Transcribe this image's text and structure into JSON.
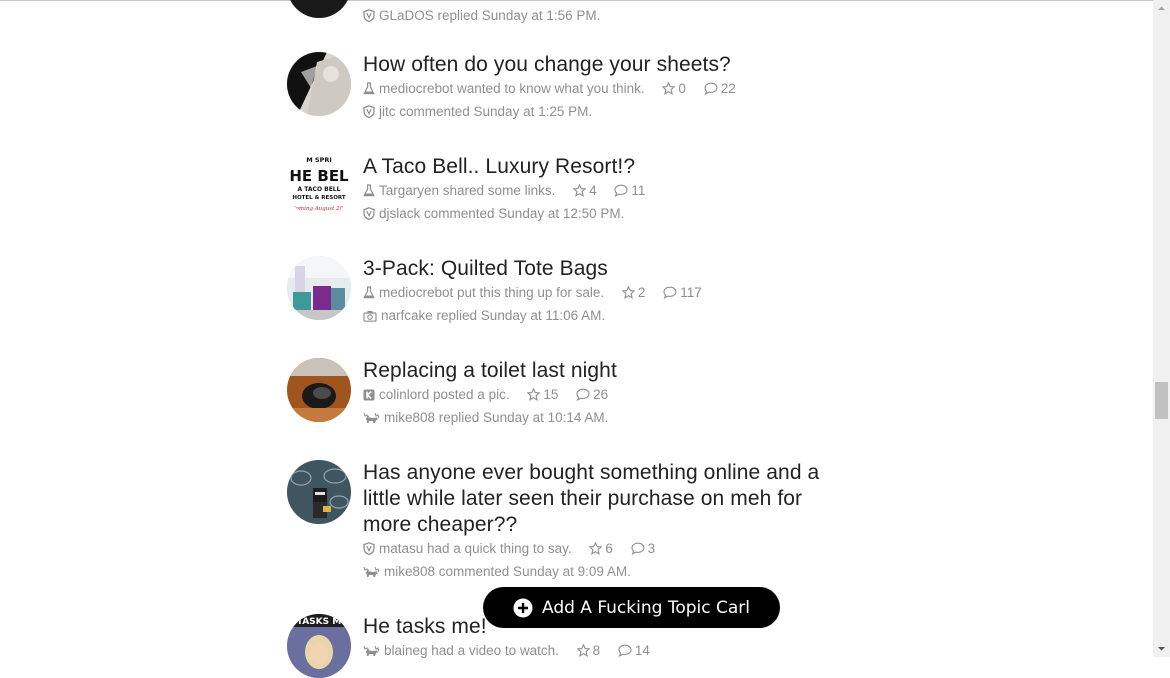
{
  "topics": [
    {
      "title": "",
      "meta_text": "",
      "reply_text": "GLaDOS replied Sunday at 1:56 PM.",
      "stars": "",
      "comments": ""
    },
    {
      "title": "How often do you change your sheets?",
      "meta_text": "mediocrebot wanted to know what you think.",
      "stars": "0",
      "comments": "22",
      "reply_text": "jitc commented Sunday at 1:25 PM."
    },
    {
      "title": "A Taco Bell.. Luxury Resort!?",
      "meta_text": "Targaryen shared some links.",
      "stars": "4",
      "comments": "11",
      "reply_text": "djslack commented Sunday at 12:50 PM.",
      "avatar_text": {
        "line1": "M SPRI",
        "line2": "HE BEL",
        "line3": "A TACO BELL",
        "line4": "HOTEL & RESORT",
        "line5": "Coming August 201"
      }
    },
    {
      "title": "3-Pack: Quilted Tote Bags",
      "meta_text": "mediocrebot put this thing up for sale.",
      "stars": "2",
      "comments": "117",
      "reply_text": "narfcake replied Sunday at 11:06 AM."
    },
    {
      "title": "Replacing a toilet last night",
      "meta_text": "colinlord posted a pic.",
      "stars": "15",
      "comments": "26",
      "reply_text": "mike808 replied Sunday at 10:14 AM."
    },
    {
      "title": "Has anyone ever bought something online and a little while later seen their purchase on meh for more cheaper??",
      "meta_text": "matasu had a quick thing to say.",
      "stars": "6",
      "comments": "3",
      "reply_text": "mike808 commented Sunday at 9:09 AM."
    },
    {
      "title": "He tasks me!",
      "meta_text": "blaineg had a video to watch.",
      "stars": "8",
      "comments": "14",
      "avatar_text": {
        "line1": "TASKS M"
      }
    }
  ],
  "add_topic_button": {
    "label": "Add A Fucking Topic Carl"
  },
  "icons": {
    "flask": "flask-icon",
    "shield": "shield-icon",
    "star": "star-icon",
    "comment": "comment-icon",
    "camera": "camera-icon",
    "k_badge": "k-badge-icon",
    "moose": "moose-icon",
    "plus": "plus-circle-icon"
  },
  "colors": {
    "meta_gray": "#8f8f8f",
    "title": "#222222",
    "button_bg": "#000000"
  }
}
